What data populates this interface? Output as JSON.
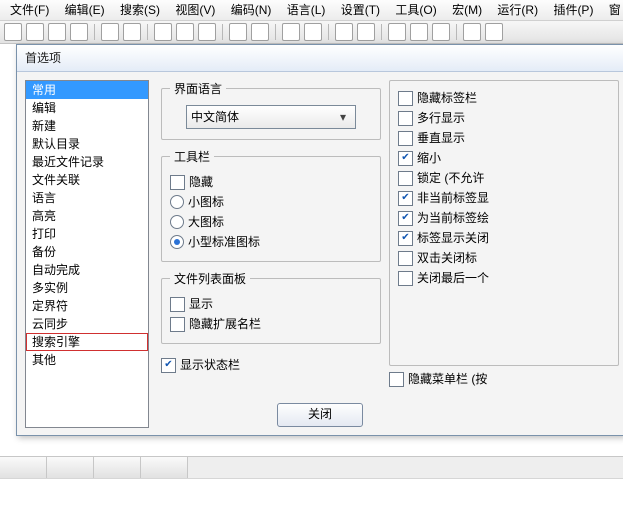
{
  "menubar": [
    "文件(F)",
    "编辑(E)",
    "搜索(S)",
    "视图(V)",
    "编码(N)",
    "语言(L)",
    "设置(T)",
    "工具(O)",
    "宏(M)",
    "运行(R)",
    "插件(P)",
    "窗"
  ],
  "dialog": {
    "title": "首选项",
    "list": [
      "常用",
      "编辑",
      "新建",
      "默认目录",
      "最近文件记录",
      "文件关联",
      "语言",
      "高亮",
      "打印",
      "备份",
      "自动完成",
      "多实例",
      "定界符",
      "云同步",
      "搜索引擎",
      "其他"
    ],
    "list_selected_index": 0,
    "list_boxed_index": 14,
    "lang_group": {
      "legend": "界面语言",
      "value": "中文简体"
    },
    "toolbar_group": {
      "legend": "工具栏",
      "hide": "隐藏",
      "small": "小图标",
      "big": "大图标",
      "std": "小型标准图标",
      "selected": "std"
    },
    "filelist_group": {
      "legend": "文件列表面板",
      "show": "显示",
      "hideext": "隐藏扩展名栏"
    },
    "statusbar": {
      "label": "显示状态栏",
      "checked": true
    },
    "right_group": {
      "items": [
        {
          "label": "隐藏标签栏",
          "checked": false
        },
        {
          "label": "多行显示",
          "checked": false
        },
        {
          "label": "垂直显示",
          "checked": false
        },
        {
          "label": "缩小",
          "checked": true
        },
        {
          "label": "锁定 (不允许",
          "checked": false
        },
        {
          "label": "非当前标签显",
          "checked": true
        },
        {
          "label": "为当前标签绘",
          "checked": true
        },
        {
          "label": "标签显示关闭",
          "checked": true
        },
        {
          "label": "双击关闭标",
          "checked": false
        },
        {
          "label": "关闭最后一个",
          "checked": false
        }
      ],
      "menu_hide": {
        "label": "隐藏菜单栏 (按",
        "checked": false
      }
    },
    "close_btn": "关闭"
  }
}
